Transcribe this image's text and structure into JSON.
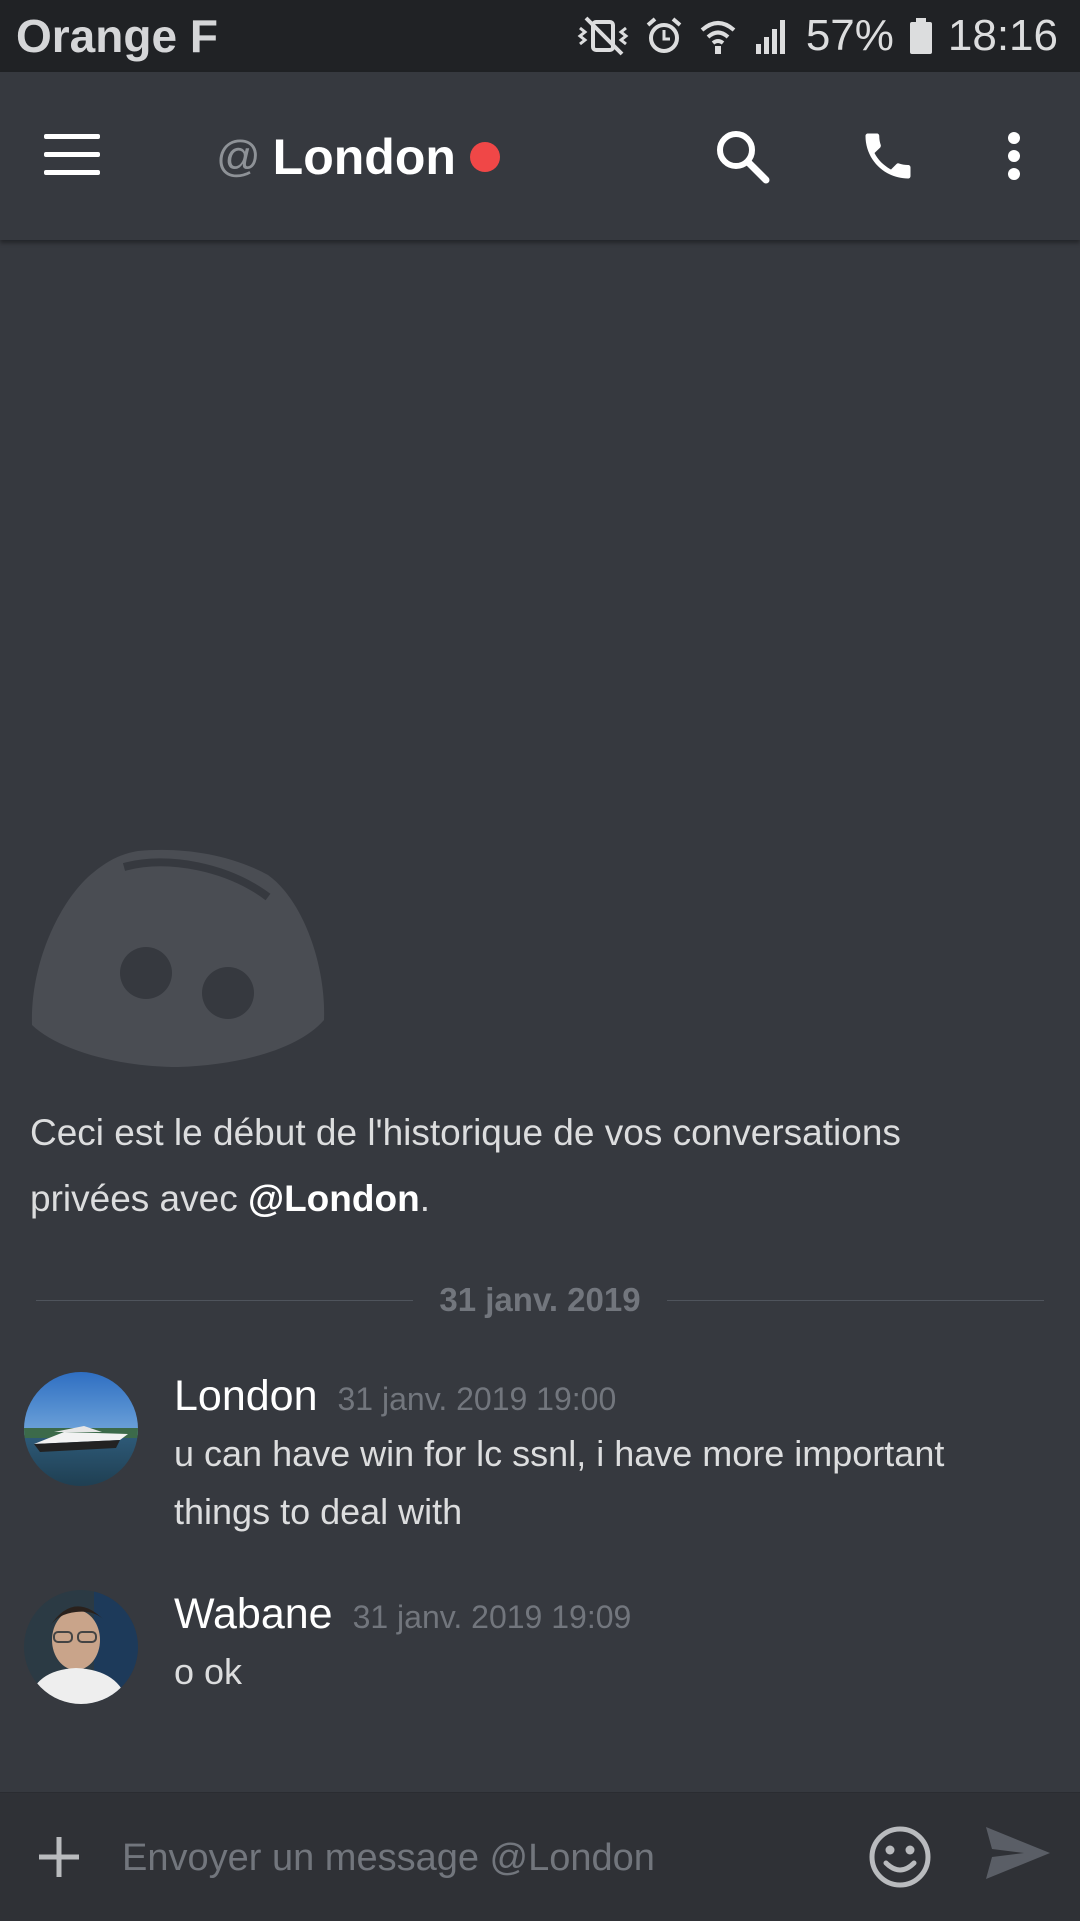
{
  "statusbar": {
    "carrier": "Orange F",
    "battery": "57%",
    "time": "18:16"
  },
  "header": {
    "at_symbol": "@",
    "channel_name": "London",
    "status": "do-not-disturb",
    "status_color": "#f04747",
    "icons": [
      "menu-icon",
      "search-icon",
      "phone-icon",
      "more-vertical-icon"
    ]
  },
  "intro": {
    "text_prefix": "Ceci est le début de l'historique de vos conversations privées avec ",
    "mention": "@London",
    "text_suffix": "."
  },
  "date_divider": "31 janv. 2019",
  "messages": [
    {
      "author": "London",
      "timestamp": "31 janv. 2019 19:00",
      "content": "u can have win for lc ssnl, i have more important things to deal with"
    },
    {
      "author": "Wabane",
      "timestamp": "31 janv. 2019 19:09",
      "content": "o ok"
    }
  ],
  "composer": {
    "placeholder": "Envoyer un message @London"
  },
  "colors": {
    "background": "#36393f",
    "statusbar": "#202225",
    "composer": "#2f3136",
    "muted": "#72767d"
  }
}
